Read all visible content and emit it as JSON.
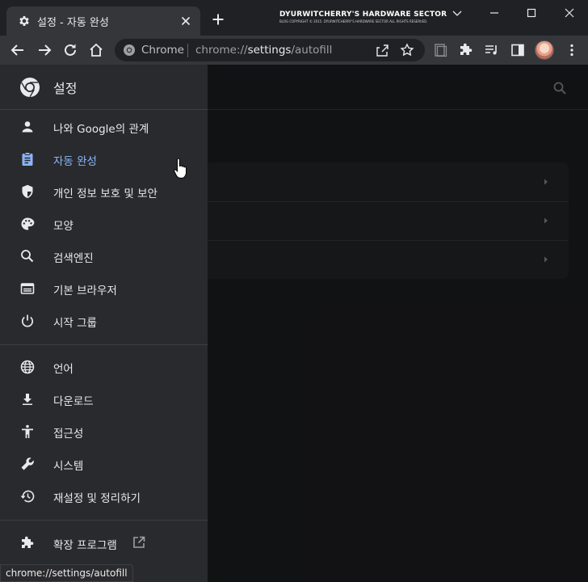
{
  "tab": {
    "title": "설정 - 자동 완성",
    "icon": "gear-icon"
  },
  "banner": {
    "title": "DYURWITCHERRY'S HARDWARE SECTOR",
    "copyright": "BLOG COPYRIGHT © 2015. DYURWITCHERRY'S HARDWARE SECTOR ALL RIGHTS RESERVED."
  },
  "omnibox": {
    "site_name": "Chrome",
    "url_scheme": "chrome://",
    "url_host": "settings",
    "url_path": "/autofill"
  },
  "drawer": {
    "title": "설정",
    "groups": [
      [
        {
          "label": "나와 Google의 관계",
          "icon": "person-icon"
        },
        {
          "label": "자동 완성",
          "icon": "clipboard-icon",
          "active": true
        },
        {
          "label": "개인 정보 보호 및 보안",
          "icon": "shield-icon"
        },
        {
          "label": "모양",
          "icon": "palette-icon"
        },
        {
          "label": "검색엔진",
          "icon": "search-icon"
        },
        {
          "label": "기본 브라우저",
          "icon": "browser-icon"
        },
        {
          "label": "시작 그룹",
          "icon": "power-icon"
        }
      ],
      [
        {
          "label": "언어",
          "icon": "globe-icon"
        },
        {
          "label": "다운로드",
          "icon": "download-icon"
        },
        {
          "label": "접근성",
          "icon": "accessibility-icon"
        },
        {
          "label": "시스템",
          "icon": "wrench-icon"
        },
        {
          "label": "재설정 및 정리하기",
          "icon": "history-icon"
        }
      ],
      [
        {
          "label": "확장 프로그램",
          "icon": "puzzle-icon"
        }
      ]
    ]
  },
  "status_url": "chrome://settings/autofill",
  "colors": {
    "accent": "#8ab4f8",
    "drawer_bg": "#292a2d",
    "page_bg": "#202124",
    "toolbar_bg": "#35363a"
  }
}
